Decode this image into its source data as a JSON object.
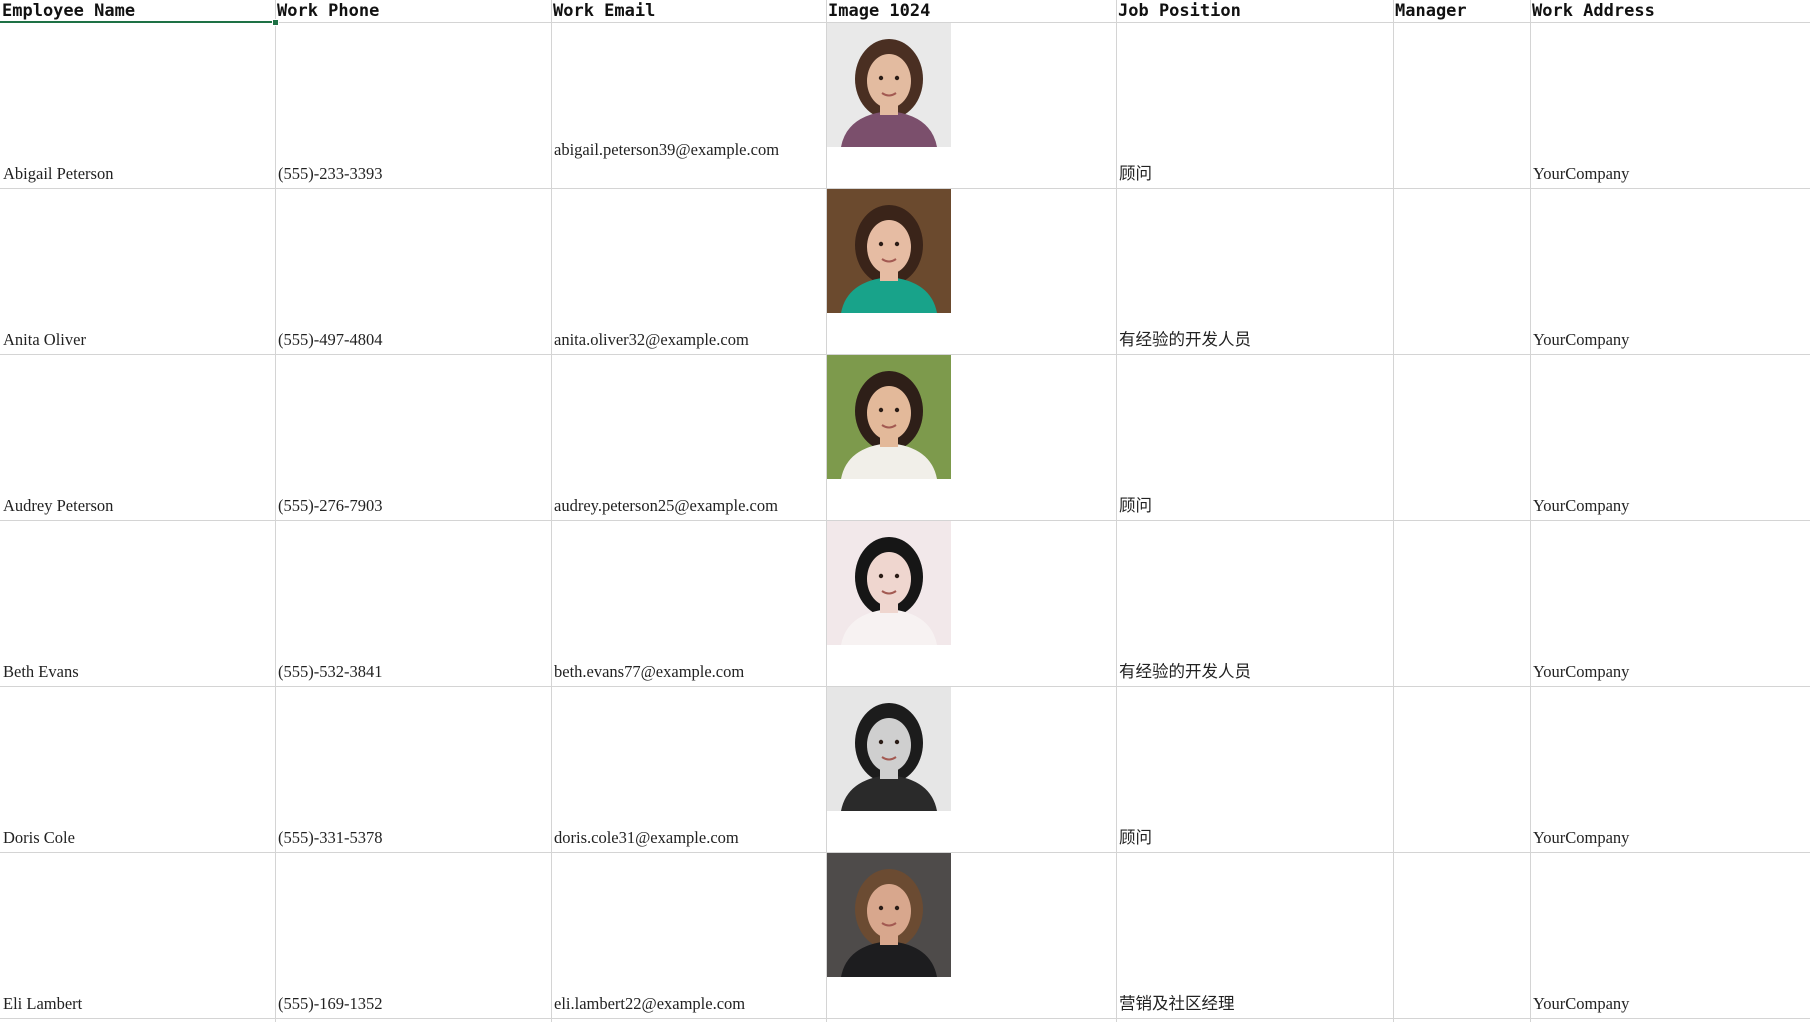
{
  "columns": [
    "Employee Name",
    "Work Phone",
    "Work Email",
    "Image 1024",
    "Job Position",
    "Manager",
    "Work Address"
  ],
  "rows": [
    {
      "name": "Abigail Peterson",
      "phone": "(555)-233-3393",
      "email": "abigail.peterson39@example.com",
      "position": "顾问",
      "manager": "",
      "address": "YourCompany",
      "photo_icon": "portrait-long-curly-dark-hair",
      "bg": "#e9e9e9",
      "skin": "#e3bba0",
      "hair": "#4a2f22",
      "shirt": "#7b4f6c"
    },
    {
      "name": "Anita Oliver",
      "phone": "(555)-497-4804",
      "email": "anita.oliver32@example.com",
      "position": "有经验的开发人员",
      "manager": "",
      "address": "YourCompany",
      "photo_icon": "portrait-smiling-brown-hair",
      "bg": "#6b4a2e",
      "skin": "#e6bca3",
      "hair": "#3a2419",
      "shirt": "#18a38a"
    },
    {
      "name": "Audrey Peterson",
      "phone": "(555)-276-7903",
      "email": "audrey.peterson25@example.com",
      "position": "顾问",
      "manager": "",
      "address": "YourCompany",
      "photo_icon": "portrait-short-dark-hair-park",
      "bg": "#7d9a4c",
      "skin": "#e3b99a",
      "hair": "#2e1f18",
      "shirt": "#f1efe9"
    },
    {
      "name": "Beth Evans",
      "phone": "(555)-532-3841",
      "email": "beth.evans77@example.com",
      "position": "有经验的开发人员",
      "manager": "",
      "address": "YourCompany",
      "photo_icon": "portrait-black-beret",
      "bg": "#f2e8ea",
      "skin": "#efd6cf",
      "hair": "#161616",
      "shirt": "#f7f2f2"
    },
    {
      "name": "Doris Cole",
      "phone": "(555)-331-5378",
      "email": "doris.cole31@example.com",
      "position": "顾问",
      "manager": "",
      "address": "YourCompany",
      "photo_icon": "portrait-beanie-glasses-bw",
      "bg": "#e6e6e6",
      "skin": "#cfcfcf",
      "hair": "#1c1c1c",
      "shirt": "#2a2a2a"
    },
    {
      "name": "Eli Lambert",
      "phone": "(555)-169-1352",
      "email": "eli.lambert22@example.com",
      "position": "营销及社区经理",
      "manager": "",
      "address": "YourCompany",
      "photo_icon": "portrait-man-beard",
      "bg": "#4e4b4a",
      "skin": "#d8a78d",
      "hair": "#6b4b32",
      "shirt": "#1d1d1f"
    }
  ]
}
